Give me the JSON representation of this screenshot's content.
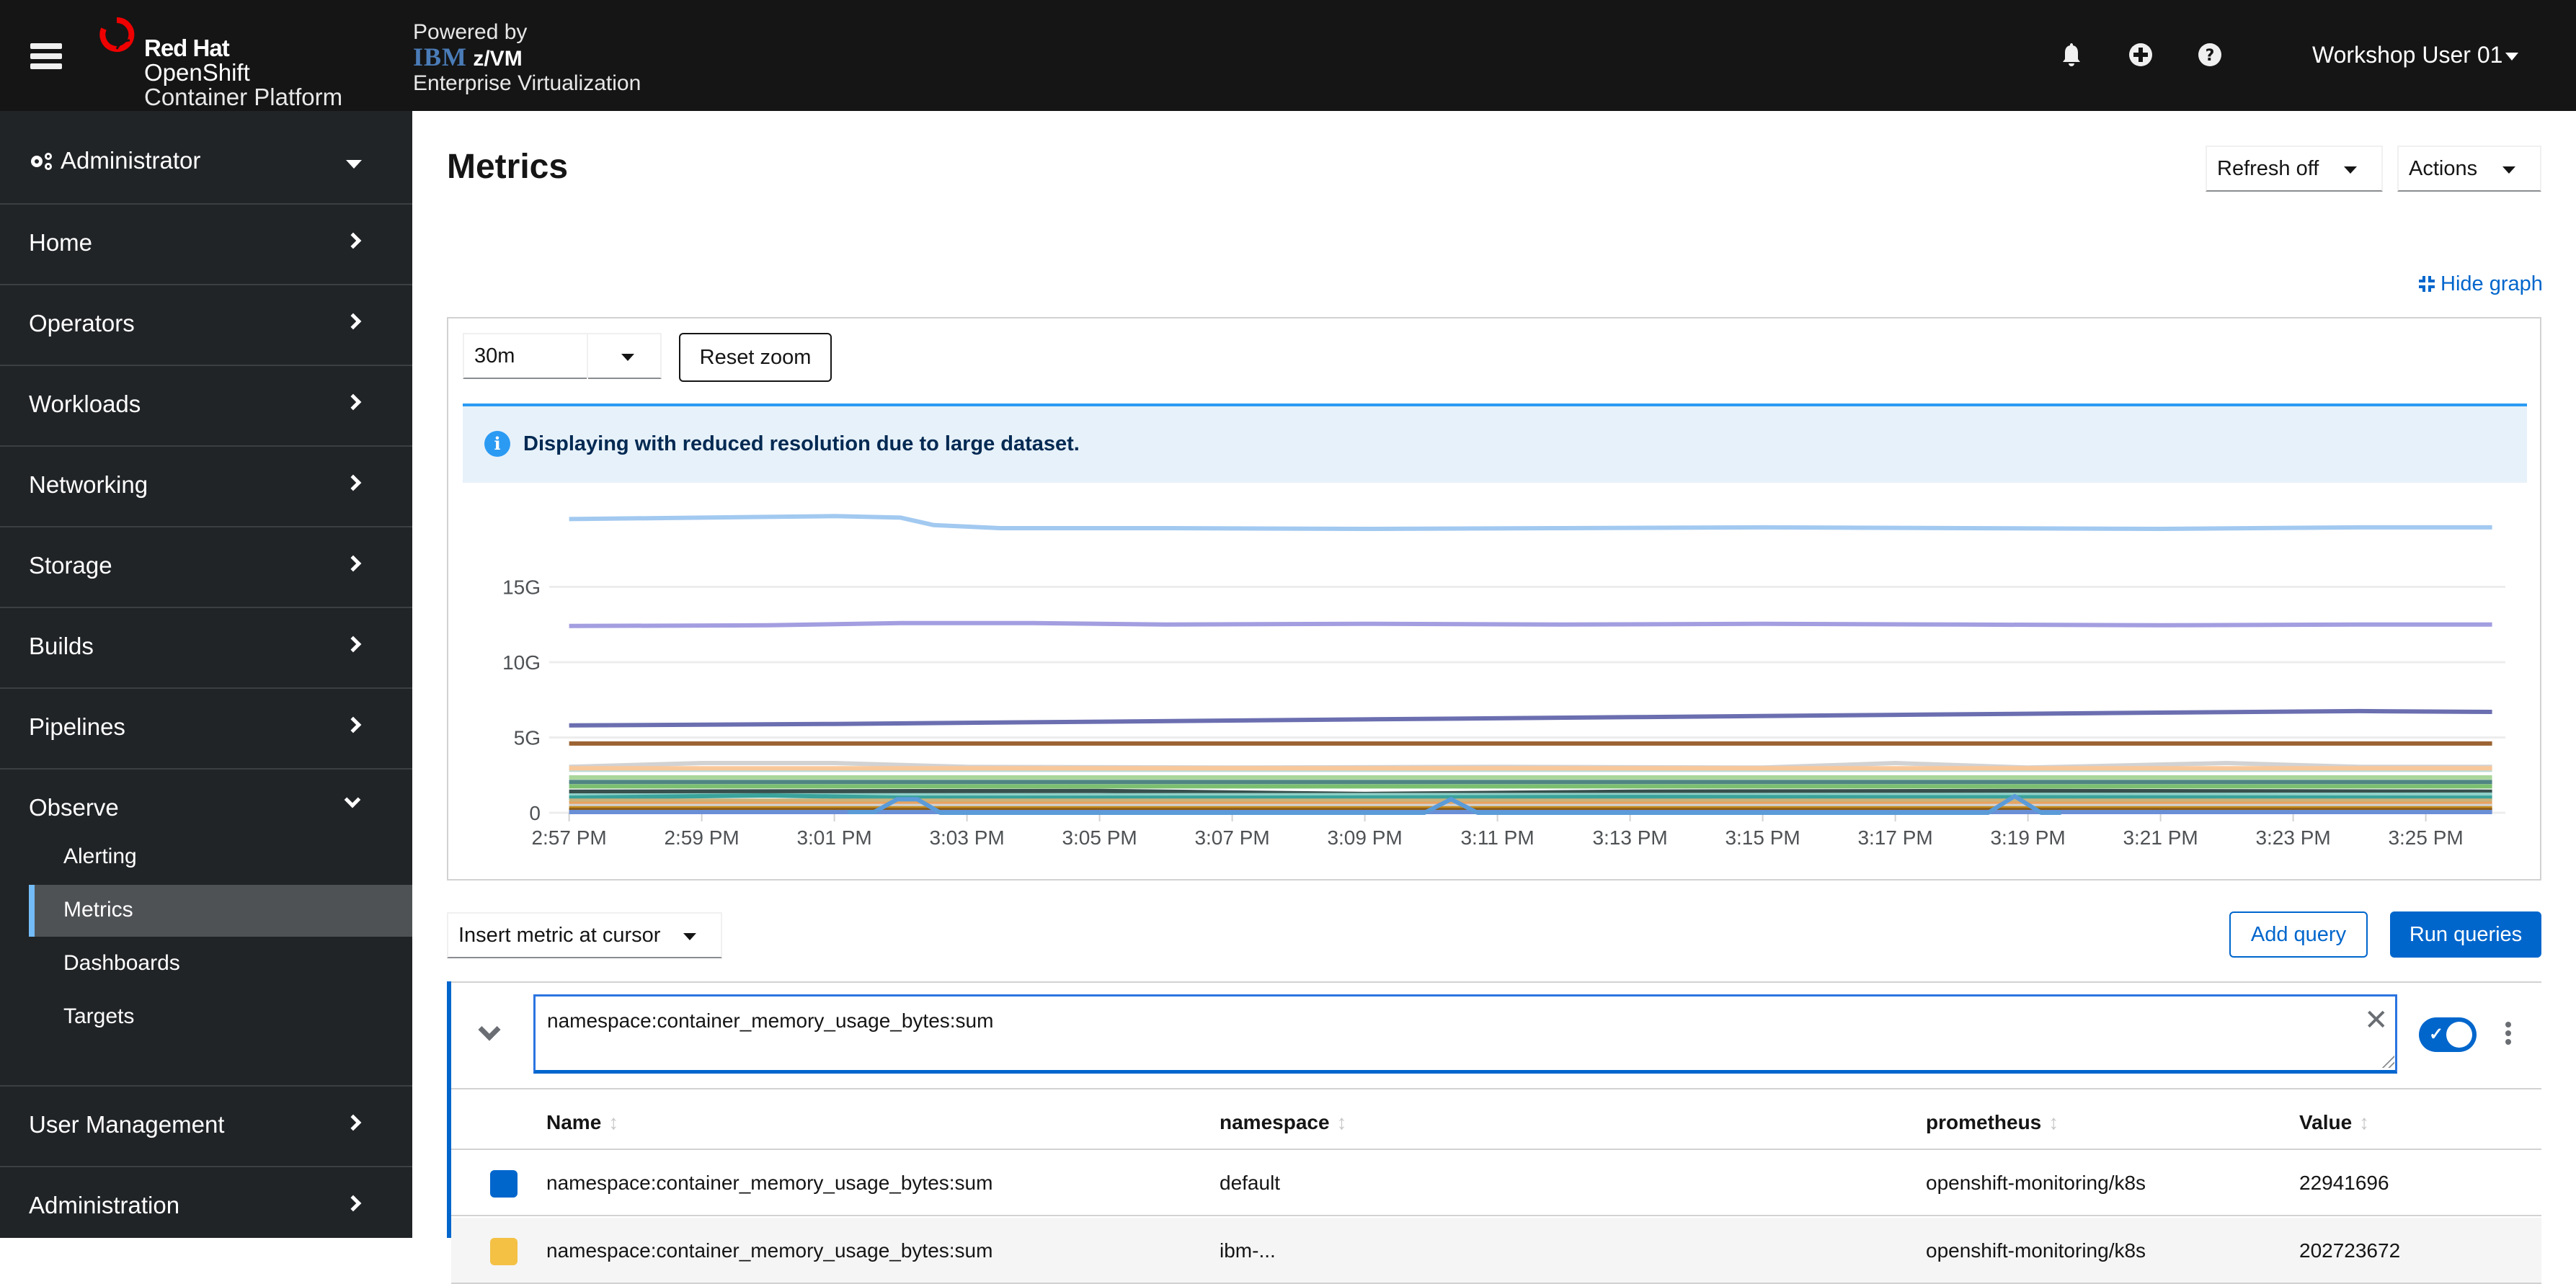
{
  "masthead": {
    "brand_line1": "Red Hat",
    "brand_line2": "OpenShift",
    "brand_line3": "Container Platform",
    "powered_by": "Powered by",
    "powered_ibm": "IBM",
    "powered_zvm": "z/VM",
    "powered_product": "Enterprise Virtualization",
    "user_menu_label": "Workshop User 01",
    "icons": [
      "menu-icon",
      "bell-icon",
      "plus-circle-icon",
      "question-circle-icon"
    ]
  },
  "sidebar": {
    "perspective": "Administrator",
    "items": [
      {
        "label": "Home",
        "expanded": false
      },
      {
        "label": "Operators",
        "expanded": false
      },
      {
        "label": "Workloads",
        "expanded": false
      },
      {
        "label": "Networking",
        "expanded": false
      },
      {
        "label": "Storage",
        "expanded": false
      },
      {
        "label": "Builds",
        "expanded": false
      },
      {
        "label": "Pipelines",
        "expanded": false
      },
      {
        "label": "Observe",
        "expanded": true
      },
      {
        "label": "User Management",
        "expanded": false
      },
      {
        "label": "Administration",
        "expanded": false
      }
    ],
    "observe_children": [
      {
        "label": "Alerting",
        "active": false
      },
      {
        "label": "Metrics",
        "active": true
      },
      {
        "label": "Dashboards",
        "active": false
      },
      {
        "label": "Targets",
        "active": false
      }
    ]
  },
  "page": {
    "title": "Metrics",
    "refresh_label": "Refresh off",
    "actions_label": "Actions",
    "hide_graph_label": "Hide graph"
  },
  "graph": {
    "time_range": "30m",
    "reset_zoom_label": "Reset zoom",
    "alert_text": "Displaying with reduced resolution due to large dataset."
  },
  "query": {
    "insert_metric_label": "Insert metric at cursor",
    "add_query_label": "Add query",
    "run_queries_label": "Run queries",
    "expression": "namespace:container_memory_usage_bytes:sum",
    "enabled": true
  },
  "table": {
    "columns": [
      "Name",
      "namespace",
      "prometheus",
      "Value"
    ],
    "rows": [
      {
        "color": "#0066cc",
        "name": "namespace:container_memory_usage_bytes:sum",
        "namespace": "default",
        "prometheus": "openshift-monitoring/k8s",
        "value": "22941696"
      },
      {
        "color": "#f4c145",
        "name": "namespace:container_memory_usage_bytes:sum",
        "namespace": "ibm-...",
        "prometheus": "openshift-monitoring/k8s",
        "value": "202723672"
      }
    ]
  },
  "colors": {
    "accent": "#0066cc",
    "masthead_bg": "#151515",
    "sidebar_bg": "#212427",
    "active_nav": "#73bcf7",
    "alert_bg": "#e7f1fa"
  },
  "chart_data": {
    "type": "line",
    "title": "",
    "xlabel": "",
    "ylabel": "",
    "x_ticks": [
      "2:57 PM",
      "2:59 PM",
      "3:01 PM",
      "3:03 PM",
      "3:05 PM",
      "3:07 PM",
      "3:09 PM",
      "3:11 PM",
      "3:13 PM",
      "3:15 PM",
      "3:17 PM",
      "3:19 PM",
      "3:21 PM",
      "3:23 PM",
      "3:25 PM"
    ],
    "y_ticks": [
      "0",
      "5G",
      "10G",
      "15G"
    ],
    "ylim_gb": [
      0,
      20
    ],
    "x_range_minutes": [
      -0.3,
      29.2
    ],
    "grid": true,
    "legend": "none",
    "series": [
      {
        "name": "series-1",
        "color": "#a2c9f0",
        "points_gb": [
          [
            0,
            19.5
          ],
          [
            2,
            19.6
          ],
          [
            4,
            19.7
          ],
          [
            5,
            19.6
          ],
          [
            5.5,
            19.1
          ],
          [
            6.5,
            18.9
          ],
          [
            9,
            18.9
          ],
          [
            12,
            18.85
          ],
          [
            15,
            18.9
          ],
          [
            18,
            18.95
          ],
          [
            21,
            18.9
          ],
          [
            24,
            18.85
          ],
          [
            27,
            18.95
          ],
          [
            29,
            18.95
          ]
        ]
      },
      {
        "name": "series-2",
        "color": "#a39ee0",
        "points_gb": [
          [
            0,
            12.4
          ],
          [
            3,
            12.45
          ],
          [
            5,
            12.6
          ],
          [
            7,
            12.6
          ],
          [
            9,
            12.5
          ],
          [
            12,
            12.55
          ],
          [
            15,
            12.5
          ],
          [
            18,
            12.55
          ],
          [
            21,
            12.5
          ],
          [
            24,
            12.45
          ],
          [
            27,
            12.5
          ],
          [
            29,
            12.5
          ]
        ]
      },
      {
        "name": "series-3",
        "color": "#6b6fb0",
        "points_gb": [
          [
            0,
            5.8
          ],
          [
            4,
            5.9
          ],
          [
            8,
            6.05
          ],
          [
            12,
            6.2
          ],
          [
            16,
            6.35
          ],
          [
            20,
            6.5
          ],
          [
            24,
            6.65
          ],
          [
            27,
            6.75
          ],
          [
            29,
            6.7
          ]
        ]
      },
      {
        "name": "series-4",
        "color": "#9c6433",
        "points_gb": [
          [
            0,
            4.6
          ],
          [
            29,
            4.6
          ]
        ]
      },
      {
        "name": "series-5",
        "color": "#d2d2d2",
        "points_gb": [
          [
            0,
            3.05
          ],
          [
            2,
            3.3
          ],
          [
            4,
            3.3
          ],
          [
            6,
            3.05
          ],
          [
            10,
            3.0
          ],
          [
            14,
            3.05
          ],
          [
            18,
            3.0
          ],
          [
            20,
            3.3
          ],
          [
            22,
            3.0
          ],
          [
            25,
            3.3
          ],
          [
            27,
            3.05
          ],
          [
            29,
            3.05
          ]
        ]
      },
      {
        "name": "series-6",
        "color": "#bcdbd5",
        "points_gb": [
          [
            0,
            2.85
          ],
          [
            29,
            2.85
          ]
        ]
      },
      {
        "name": "series-7",
        "color": "#f9c89a",
        "points_gb": [
          [
            0,
            2.95
          ],
          [
            29,
            2.95
          ]
        ]
      },
      {
        "name": "series-8",
        "color": "#a9d69a",
        "points_gb": [
          [
            0,
            2.35
          ],
          [
            29,
            2.35
          ]
        ]
      },
      {
        "name": "series-9",
        "color": "#4f8583",
        "points_gb": [
          [
            0,
            2.05
          ],
          [
            29,
            2.05
          ]
        ]
      },
      {
        "name": "series-10",
        "color": "#7cc06f",
        "points_gb": [
          [
            0,
            1.75
          ],
          [
            29,
            1.75
          ]
        ]
      },
      {
        "name": "series-11",
        "color": "#37504d",
        "points_gb": [
          [
            0,
            1.4
          ],
          [
            8,
            1.45
          ],
          [
            12,
            1.25
          ],
          [
            16,
            1.4
          ],
          [
            22,
            1.45
          ],
          [
            29,
            1.4
          ]
        ]
      },
      {
        "name": "series-12",
        "color": "#8fd0c8",
        "points_gb": [
          [
            0,
            1.15
          ],
          [
            29,
            1.2
          ]
        ]
      },
      {
        "name": "series-13",
        "color": "#3aa39b",
        "points_gb": [
          [
            0,
            1.0
          ],
          [
            3,
            1.15
          ],
          [
            5,
            1.0
          ],
          [
            10,
            1.0
          ],
          [
            16,
            1.05
          ],
          [
            29,
            1.0
          ]
        ]
      },
      {
        "name": "series-14",
        "color": "#c9b27a",
        "points_gb": [
          [
            0,
            0.8
          ],
          [
            29,
            0.8
          ]
        ]
      },
      {
        "name": "series-15",
        "color": "#e8a25e",
        "points_gb": [
          [
            0,
            0.6
          ],
          [
            29,
            0.6
          ]
        ]
      },
      {
        "name": "series-16",
        "color": "#d2d2d2",
        "points_gb": [
          [
            0,
            0.45
          ],
          [
            29,
            0.45
          ]
        ]
      },
      {
        "name": "series-17",
        "color": "#c58c1e",
        "points_gb": [
          [
            0,
            0.3
          ],
          [
            29,
            0.3
          ]
        ]
      },
      {
        "name": "series-18",
        "color": "#8a5a1a",
        "points_gb": [
          [
            0,
            0.18
          ],
          [
            29,
            0.18
          ]
        ]
      },
      {
        "name": "series-19",
        "color": "#6a8fd6",
        "points_gb": [
          [
            0,
            0.05
          ],
          [
            29,
            0.05
          ]
        ]
      },
      {
        "name": "series-20",
        "color": "#5b9bd8",
        "points_gb": [
          [
            4.2,
            0.05
          ],
          [
            4.6,
            0.05
          ],
          [
            4.95,
            0.9
          ],
          [
            5.25,
            0.9
          ],
          [
            5.6,
            0.0
          ],
          [
            12.9,
            0.0
          ],
          [
            13.3,
            0.9
          ],
          [
            13.7,
            0.0
          ],
          [
            21.4,
            0.0
          ],
          [
            21.8,
            1.1
          ],
          [
            22.2,
            0.0
          ],
          [
            22.5,
            0.0
          ]
        ]
      }
    ]
  }
}
